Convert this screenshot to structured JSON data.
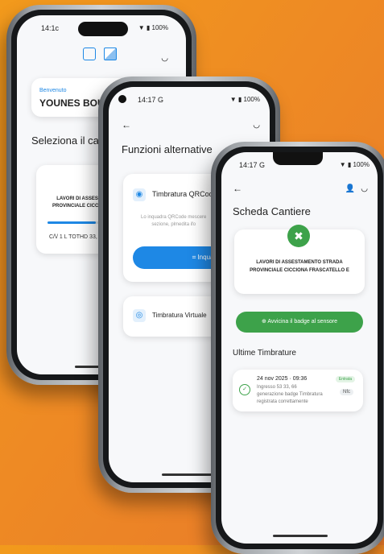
{
  "phone1": {
    "status_time": "14:1c",
    "status_batt": "▼ ▮ 100%",
    "label": "Benvenuto",
    "name": "YOUNES BOUSA",
    "section_title": "Seleziona il cantie",
    "site_name": "LAVORI DI ASSESTA\nPROVINCIALE CICCIONI",
    "site_code": "C/\\/ 1 L TOTHD 33, 6"
  },
  "phone2": {
    "status_time": "14:17 G",
    "status_batt": "▼ ▮ 100%",
    "title": "Funzioni alternative",
    "qr_title": "Timbratura QRCode",
    "qr_desc": "Lo inquadra QRCode mescere\nsezione, plmedita ifo",
    "qr_button": "Inquadra QR",
    "virtual_title": "Timbratura Virtuale"
  },
  "phone3": {
    "status_time": "14:17 G",
    "status_batt": "▼ ▮ 100%",
    "title": "Scheda Cantiere",
    "site_name": "LAVORI DI ASSESTAMENTO STRADA\nPROVINCIALE CICCIONA FRASCATELLO E",
    "badge_button": "Avvicina il badge al sensore",
    "timbrature_title": "Ultime Timbrature",
    "entry_date": "24 nov 2025 · 09:36",
    "entry_line1": "Ingresso 53 33, 66",
    "entry_line2": "generazione badge Timbratura",
    "entry_line3": "registrata correttamente",
    "entry_badge": "Entrata",
    "entry_type": "Nfc"
  },
  "colors": {
    "green": "#3da24a",
    "blue": "#1e88e5",
    "background": "#ee8a24"
  }
}
